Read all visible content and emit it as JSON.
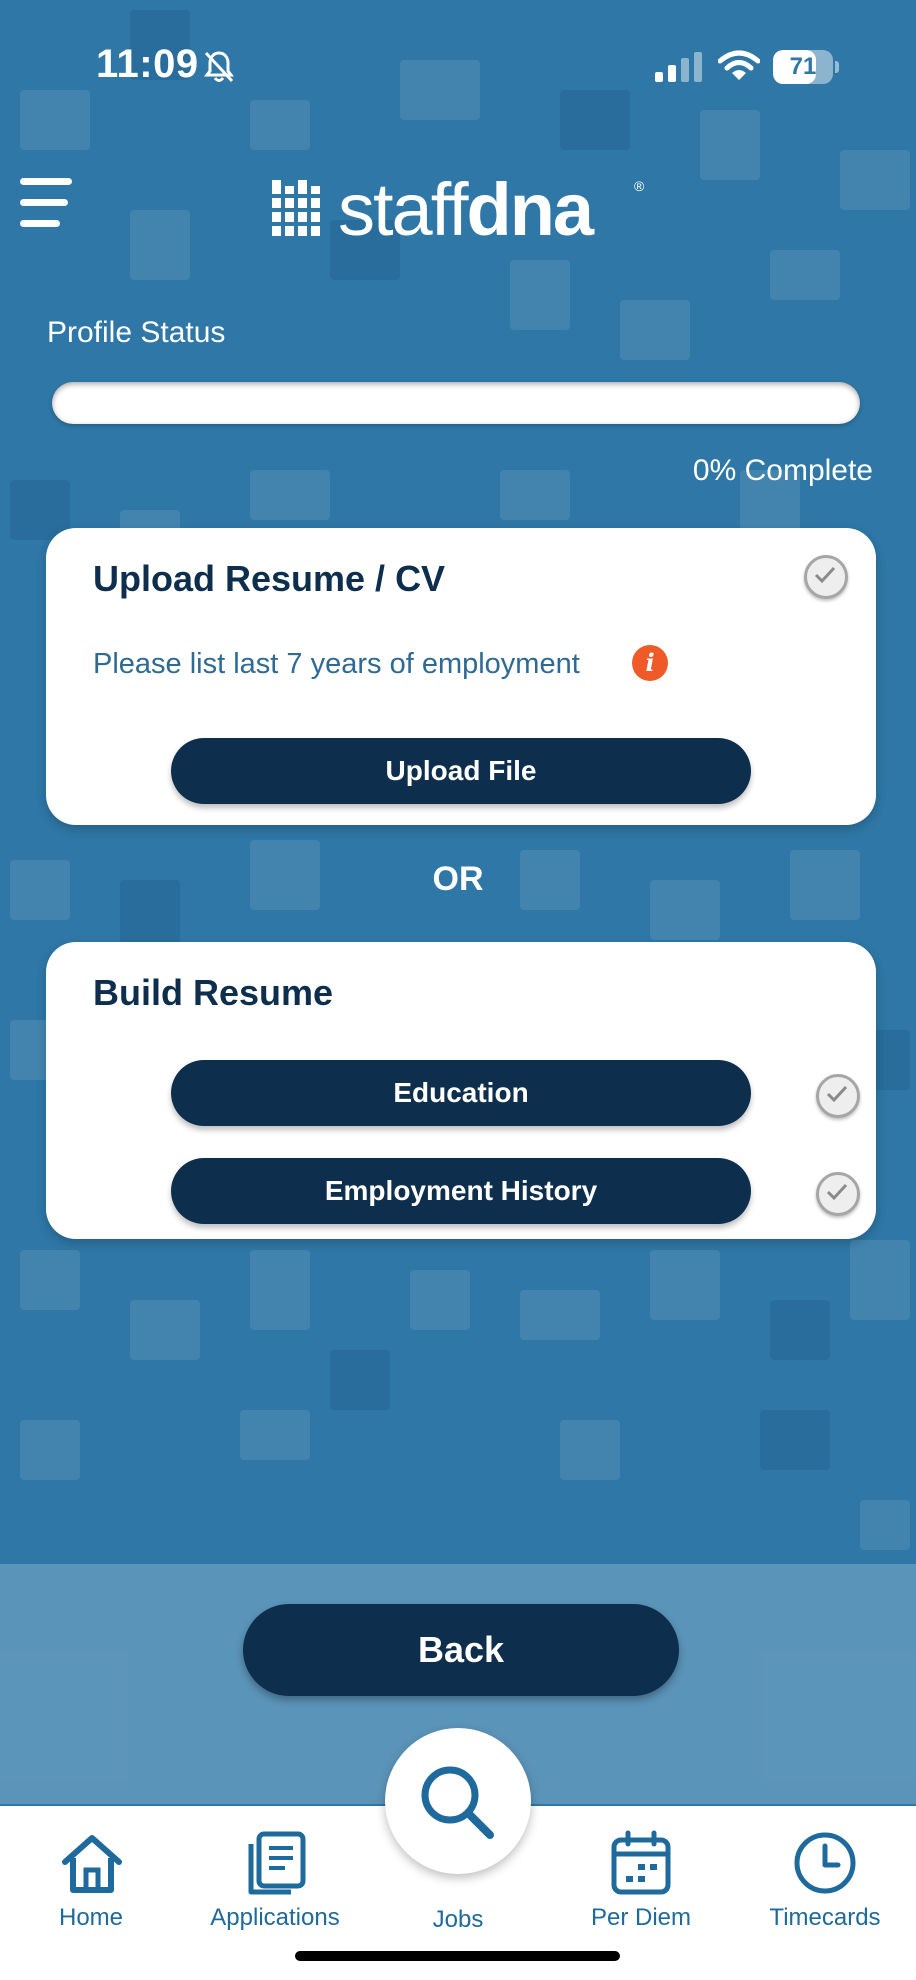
{
  "status_bar": {
    "time": "11:09",
    "battery": "71",
    "battery_level": 0.71
  },
  "header": {
    "logo_light": "staff",
    "logo_bold": "dna",
    "logo_mark": "®"
  },
  "profile": {
    "label": "Profile Status",
    "progress_text": "0% Complete",
    "progress_fraction": 0.0
  },
  "upload_card": {
    "title": "Upload Resume / CV",
    "note": "Please list last 7 years of employment",
    "info_icon": "i",
    "button": "Upload File"
  },
  "divider": {
    "or": "OR"
  },
  "build_card": {
    "title": "Build Resume",
    "buttons": [
      "Education",
      "Employment History"
    ]
  },
  "back_button": "Back",
  "tabs": [
    "Home",
    "Applications",
    "Jobs",
    "Per Diem",
    "Timecards"
  ],
  "colors": {
    "background": "#2e77a6",
    "navy": "#0d2f4d",
    "info": "#ef5a28",
    "tab_blue": "#1f6a9c"
  },
  "icons": [
    "bell-slash-icon",
    "signal-icon",
    "wifi-icon",
    "battery-icon",
    "menu-icon",
    "check-circle-icon",
    "info-icon",
    "home-icon",
    "applications-icon",
    "search-icon",
    "calendar-icon",
    "clock-icon"
  ]
}
